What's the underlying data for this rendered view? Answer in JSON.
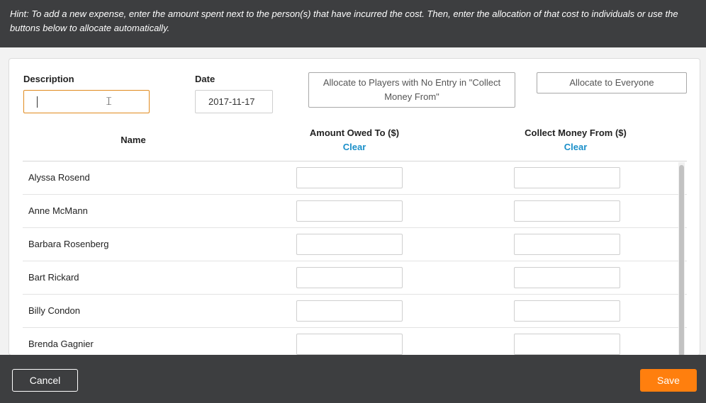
{
  "hint": "Hint: To add a new expense, enter the amount spent next to the person(s) that have incurred the cost. Then, enter the allocation of that cost to individuals or use the buttons below to allocate automatically.",
  "form": {
    "description_label": "Description",
    "description_value": "",
    "date_label": "Date",
    "date_value": "2017-11-17"
  },
  "actions": {
    "allocate_no_entry": "Allocate to Players with No Entry in \"Collect Money From\"",
    "allocate_everyone": "Allocate to Everyone"
  },
  "table": {
    "name_header": "Name",
    "owed_header": "Amount Owed To ($)",
    "collect_header": "Collect Money From ($)",
    "clear_label": "Clear",
    "rows": [
      {
        "name": "Alyssa Rosend"
      },
      {
        "name": "Anne McMann"
      },
      {
        "name": "Barbara Rosenberg"
      },
      {
        "name": "Bart Rickard"
      },
      {
        "name": "Billy Condon"
      },
      {
        "name": "Brenda Gagnier"
      }
    ]
  },
  "footer": {
    "cancel_label": "Cancel",
    "save_label": "Save"
  },
  "colors": {
    "accent": "#ff7f0e",
    "link": "#1a8fc9",
    "dark_bar": "#3d3e40",
    "focus_border": "#e08a1e"
  }
}
